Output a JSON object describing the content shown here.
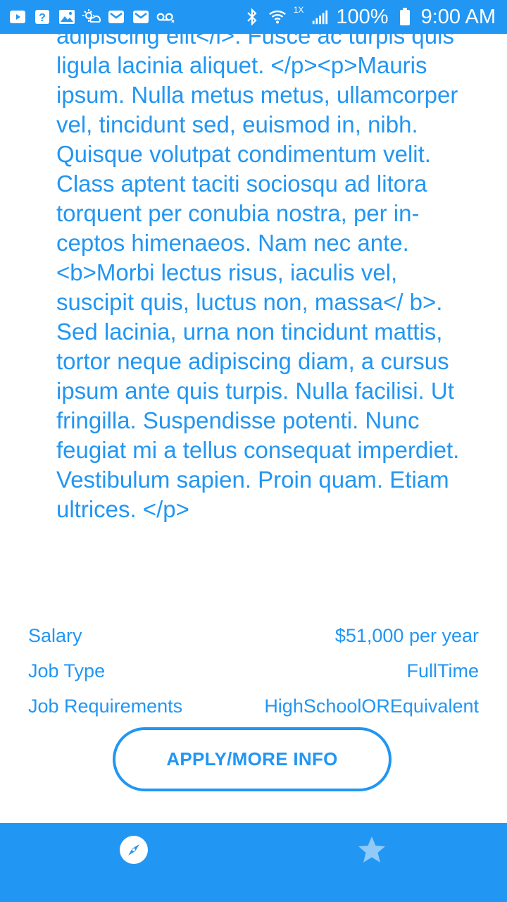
{
  "status_bar": {
    "battery": "100%",
    "time": "9:00 AM",
    "network_small": "1X",
    "colors": {
      "bar": "#2196f3"
    },
    "icons_left": [
      "play-icon",
      "help-icon",
      "image-icon",
      "weather-icon",
      "mail-icon",
      "mail-icon",
      "voicemail-icon"
    ],
    "icons_right": [
      "bluetooth-icon",
      "wifi-icon",
      "signal-icon",
      "battery-icon"
    ]
  },
  "description": {
    "text": "adipiscing elit</i>. Fusce ac turpis quis ligula lacinia aliquet. </p><p>Mauris ipsum. Nulla metus metus, ullamcorper vel, tincidunt sed, euismod in, nibh. Quisque volutpat condimentum velit. Class aptent taciti sociosqu ad litora torquent per conubia nostra, per in- ceptos himenaeos. Nam nec ante. <b>Morbi lectus risus, iaculis vel, suscipit quis, luctus non, massa</ b>. Sed lacinia, urna non tincidunt mattis, tortor neque adipiscing diam, a cursus ipsum ante quis turpis. Nulla facilisi. Ut fringilla. Suspendisse potenti. Nunc feugiat mi a tellus consequat imperdiet. Vestibulum sapien. Proin quam. Etiam ultrices. </p>"
  },
  "details": [
    {
      "label": "Salary",
      "value": "$51,000 per year"
    },
    {
      "label": "Job Type",
      "value": "FullTime"
    },
    {
      "label": "Job Requirements",
      "value": "HighSchoolOREquivalent"
    }
  ],
  "apply_button": {
    "label": "APPLY/MORE INFO"
  },
  "bottom_nav": {
    "items": [
      {
        "icon": "compass-icon"
      },
      {
        "icon": "star-icon"
      }
    ],
    "colors": {
      "accent": "#2196f3"
    }
  }
}
